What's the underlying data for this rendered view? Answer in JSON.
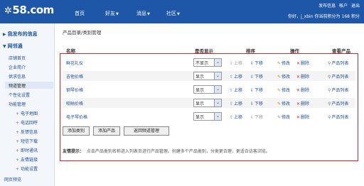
{
  "header": {
    "logo": "58.com",
    "nav": [
      "首页",
      "好友",
      "消息",
      "社区"
    ],
    "links": [
      "发布信息",
      "帐户",
      "退出"
    ],
    "user_info": [
      "你好，j_xbin",
      "你当前积分为",
      "168",
      "积分"
    ]
  },
  "sidebar": {
    "heads": [
      "我发布的信息",
      "网邻通"
    ],
    "items": [
      "店铺首页",
      "企业简介",
      "供求信息",
      "频道管理",
      "个性化设置",
      "功能管理"
    ],
    "sub_items": [
      "电子地图",
      "电话回呼",
      "反馈信息",
      "短信下载",
      "即时通讯",
      "友情链接",
      "功能设置"
    ],
    "footer": "网页预览"
  },
  "breadcrumb": "产品目录/类别管理",
  "table": {
    "headers": [
      "名称",
      "是否显示",
      "排序",
      "操作",
      "查看产品"
    ],
    "rows": [
      {
        "name": "鲜花礼仪",
        "visibility": "不显示",
        "up": "上移",
        "down": "下移",
        "edit": "修改",
        "delete": "删除",
        "view": "产品列表"
      },
      {
        "name": "吉他价格",
        "visibility": "显示",
        "up": "上移",
        "down": "下移",
        "edit": "修改",
        "delete": "删除",
        "view": "产品列表"
      },
      {
        "name": "钢琴价格",
        "visibility": "显示",
        "up": "上移",
        "down": "下移",
        "edit": "修改",
        "delete": "删除",
        "view": "产品列表"
      },
      {
        "name": "唢呐价格",
        "visibility": "显示",
        "up": "上移",
        "down": "下移",
        "edit": "修改",
        "delete": "删除",
        "view": "产品列表"
      },
      {
        "name": "电子琴价格",
        "visibility": "显示",
        "up": "上移",
        "down": "下移",
        "edit": "修改",
        "delete": "删除",
        "view": "产品列表"
      }
    ]
  },
  "buttons": [
    "添加类别",
    "添加产品",
    "返回频道管理"
  ],
  "tip": {
    "label": "友情提示：",
    "text": "点击产品类别名称进入列表页进行产品管理。创建多个产品类别，分类更合理，更适合访客浏览。"
  }
}
